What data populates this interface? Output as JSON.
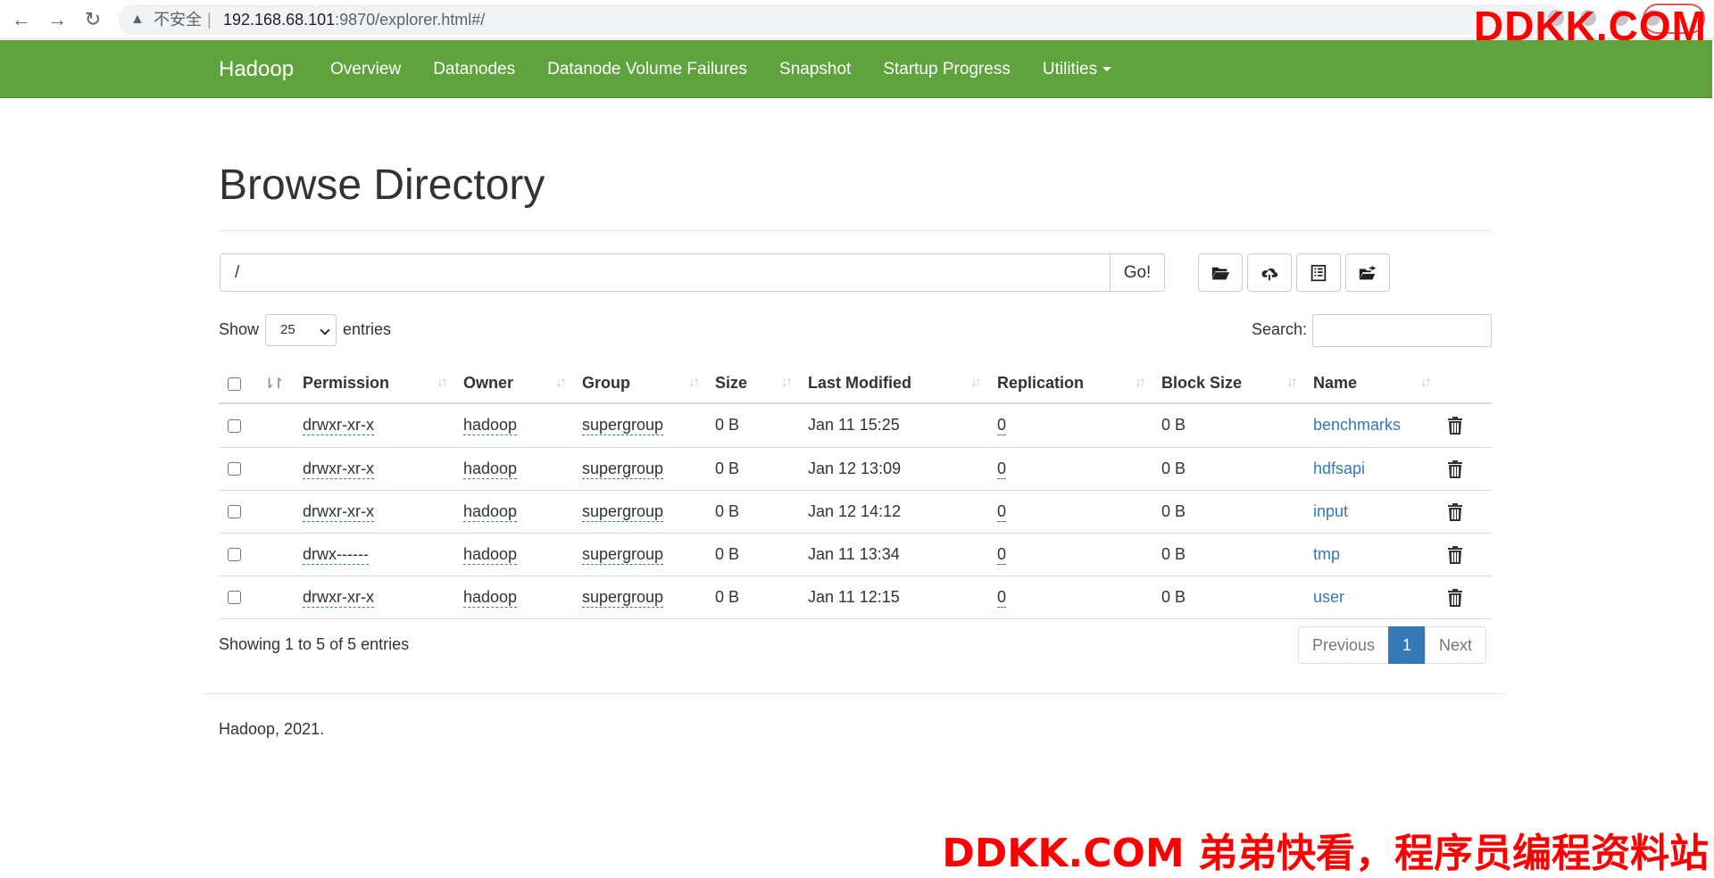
{
  "browser": {
    "back_icon": "←",
    "forward_icon": "→",
    "reload_icon": "↻",
    "insecure_label": "不安全",
    "url_host": "192.168.68.101",
    "url_rest": ":9870/explorer.html#/"
  },
  "watermark": {
    "top": "DDKK.COM",
    "bottom": "DDKK.COM 弟弟快看，程序员编程资料站"
  },
  "navbar": {
    "brand": "Hadoop",
    "links": [
      "Overview",
      "Datanodes",
      "Datanode Volume Failures",
      "Snapshot",
      "Startup Progress",
      "Utilities"
    ]
  },
  "page": {
    "title": "Browse Directory",
    "path_value": "/",
    "go_label": "Go!",
    "show_label": "Show",
    "page_size": "25",
    "entries_label": "entries",
    "search_label": "Search:",
    "showing_text": "Showing 1 to 5 of 5 entries",
    "footer": "Hadoop, 2021."
  },
  "table": {
    "headers": [
      "Permission",
      "Owner",
      "Group",
      "Size",
      "Last Modified",
      "Replication",
      "Block Size",
      "Name"
    ],
    "rows": [
      {
        "permission": "drwxr-xr-x",
        "owner": "hadoop",
        "group": "supergroup",
        "size": "0 B",
        "modified": "Jan 11 15:25",
        "replication": "0",
        "block_size": "0 B",
        "name": "benchmarks"
      },
      {
        "permission": "drwxr-xr-x",
        "owner": "hadoop",
        "group": "supergroup",
        "size": "0 B",
        "modified": "Jan 12 13:09",
        "replication": "0",
        "block_size": "0 B",
        "name": "hdfsapi"
      },
      {
        "permission": "drwxr-xr-x",
        "owner": "hadoop",
        "group": "supergroup",
        "size": "0 B",
        "modified": "Jan 12 14:12",
        "replication": "0",
        "block_size": "0 B",
        "name": "input"
      },
      {
        "permission": "drwx------",
        "owner": "hadoop",
        "group": "supergroup",
        "size": "0 B",
        "modified": "Jan 11 13:34",
        "replication": "0",
        "block_size": "0 B",
        "name": "tmp"
      },
      {
        "permission": "drwxr-xr-x",
        "owner": "hadoop",
        "group": "supergroup",
        "size": "0 B",
        "modified": "Jan 11 12:15",
        "replication": "0",
        "block_size": "0 B",
        "name": "user"
      }
    ]
  },
  "pagination": {
    "previous": "Previous",
    "current": "1",
    "next": "Next"
  },
  "colors": {
    "navbar": "#5fa33e",
    "link": "#337ab7",
    "watermark": "#ff0000"
  },
  "icons": {
    "toolbar": [
      "folder-open-icon",
      "cloud-upload-icon",
      "list-alt-icon",
      "folder-move-icon"
    ],
    "row_action": "trash-icon"
  }
}
